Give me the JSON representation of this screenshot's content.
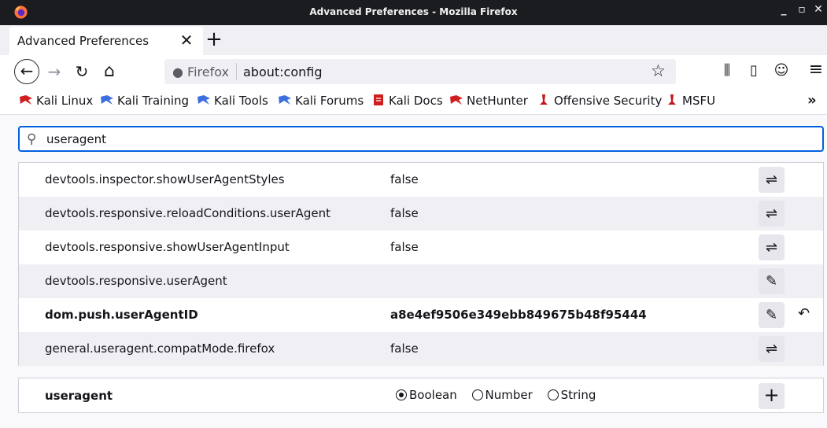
{
  "window": {
    "title": "Advanced Preferences - Mozilla Firefox",
    "controls": {
      "minimize": "_",
      "maximize": "▫",
      "close": "✕"
    }
  },
  "tab": {
    "label": "Advanced Preferences",
    "close": "✕",
    "new_tab": "+"
  },
  "nav": {
    "back": "←",
    "forward": "→",
    "reload": "↻",
    "home": "⌂",
    "identity_label": "Firefox",
    "url": "about:config",
    "star": "☆",
    "library": "⫼",
    "sidebar": "▯",
    "account": "☺",
    "menu": "≡"
  },
  "bookmarks": {
    "items": [
      {
        "label": "Kali Linux",
        "icon": "kali-dragon-red-icon"
      },
      {
        "label": "Kali Training",
        "icon": "kali-dragon-blue-icon"
      },
      {
        "label": "Kali Tools",
        "icon": "kali-dragon-blue-icon"
      },
      {
        "label": "Kali Forums",
        "icon": "kali-dragon-blue-icon"
      },
      {
        "label": "Kali Docs",
        "icon": "kali-docs-red-icon"
      },
      {
        "label": "NetHunter",
        "icon": "kali-dragon-red-icon"
      },
      {
        "label": "Offensive Security",
        "icon": "offsec-red-icon"
      },
      {
        "label": "MSFU",
        "icon": "offsec-red-icon"
      }
    ],
    "more": "»"
  },
  "search": {
    "value": "useragent",
    "icon": "search-icon"
  },
  "prefs": [
    {
      "name": "devtools.inspector.showUserAgentStyles",
      "value": "false",
      "action": "⇌",
      "action_type": "toggle",
      "modified": false
    },
    {
      "name": "devtools.responsive.reloadConditions.userAgent",
      "value": "false",
      "action": "⇌",
      "action_type": "toggle",
      "modified": false
    },
    {
      "name": "devtools.responsive.showUserAgentInput",
      "value": "false",
      "action": "⇌",
      "action_type": "toggle",
      "modified": false
    },
    {
      "name": "devtools.responsive.userAgent",
      "value": "",
      "action": "✎",
      "action_type": "edit",
      "modified": false
    },
    {
      "name": "dom.push.userAgentID",
      "value": "a8e4ef9506e349ebb849675b48f95444",
      "action": "✎",
      "action_type": "edit",
      "modified": true,
      "reset": "↶"
    },
    {
      "name": "general.useragent.compatMode.firefox",
      "value": "false",
      "action": "⇌",
      "action_type": "toggle",
      "modified": false
    }
  ],
  "new_pref": {
    "name": "useragent",
    "types": [
      "Boolean",
      "Number",
      "String"
    ],
    "selected_type": "Boolean",
    "add": "+"
  },
  "colors": {
    "titlebar": "#1b1c1f",
    "focus": "#0061e0",
    "kali_blue": "#3d6ee0",
    "kali_red": "#d01d1d"
  }
}
